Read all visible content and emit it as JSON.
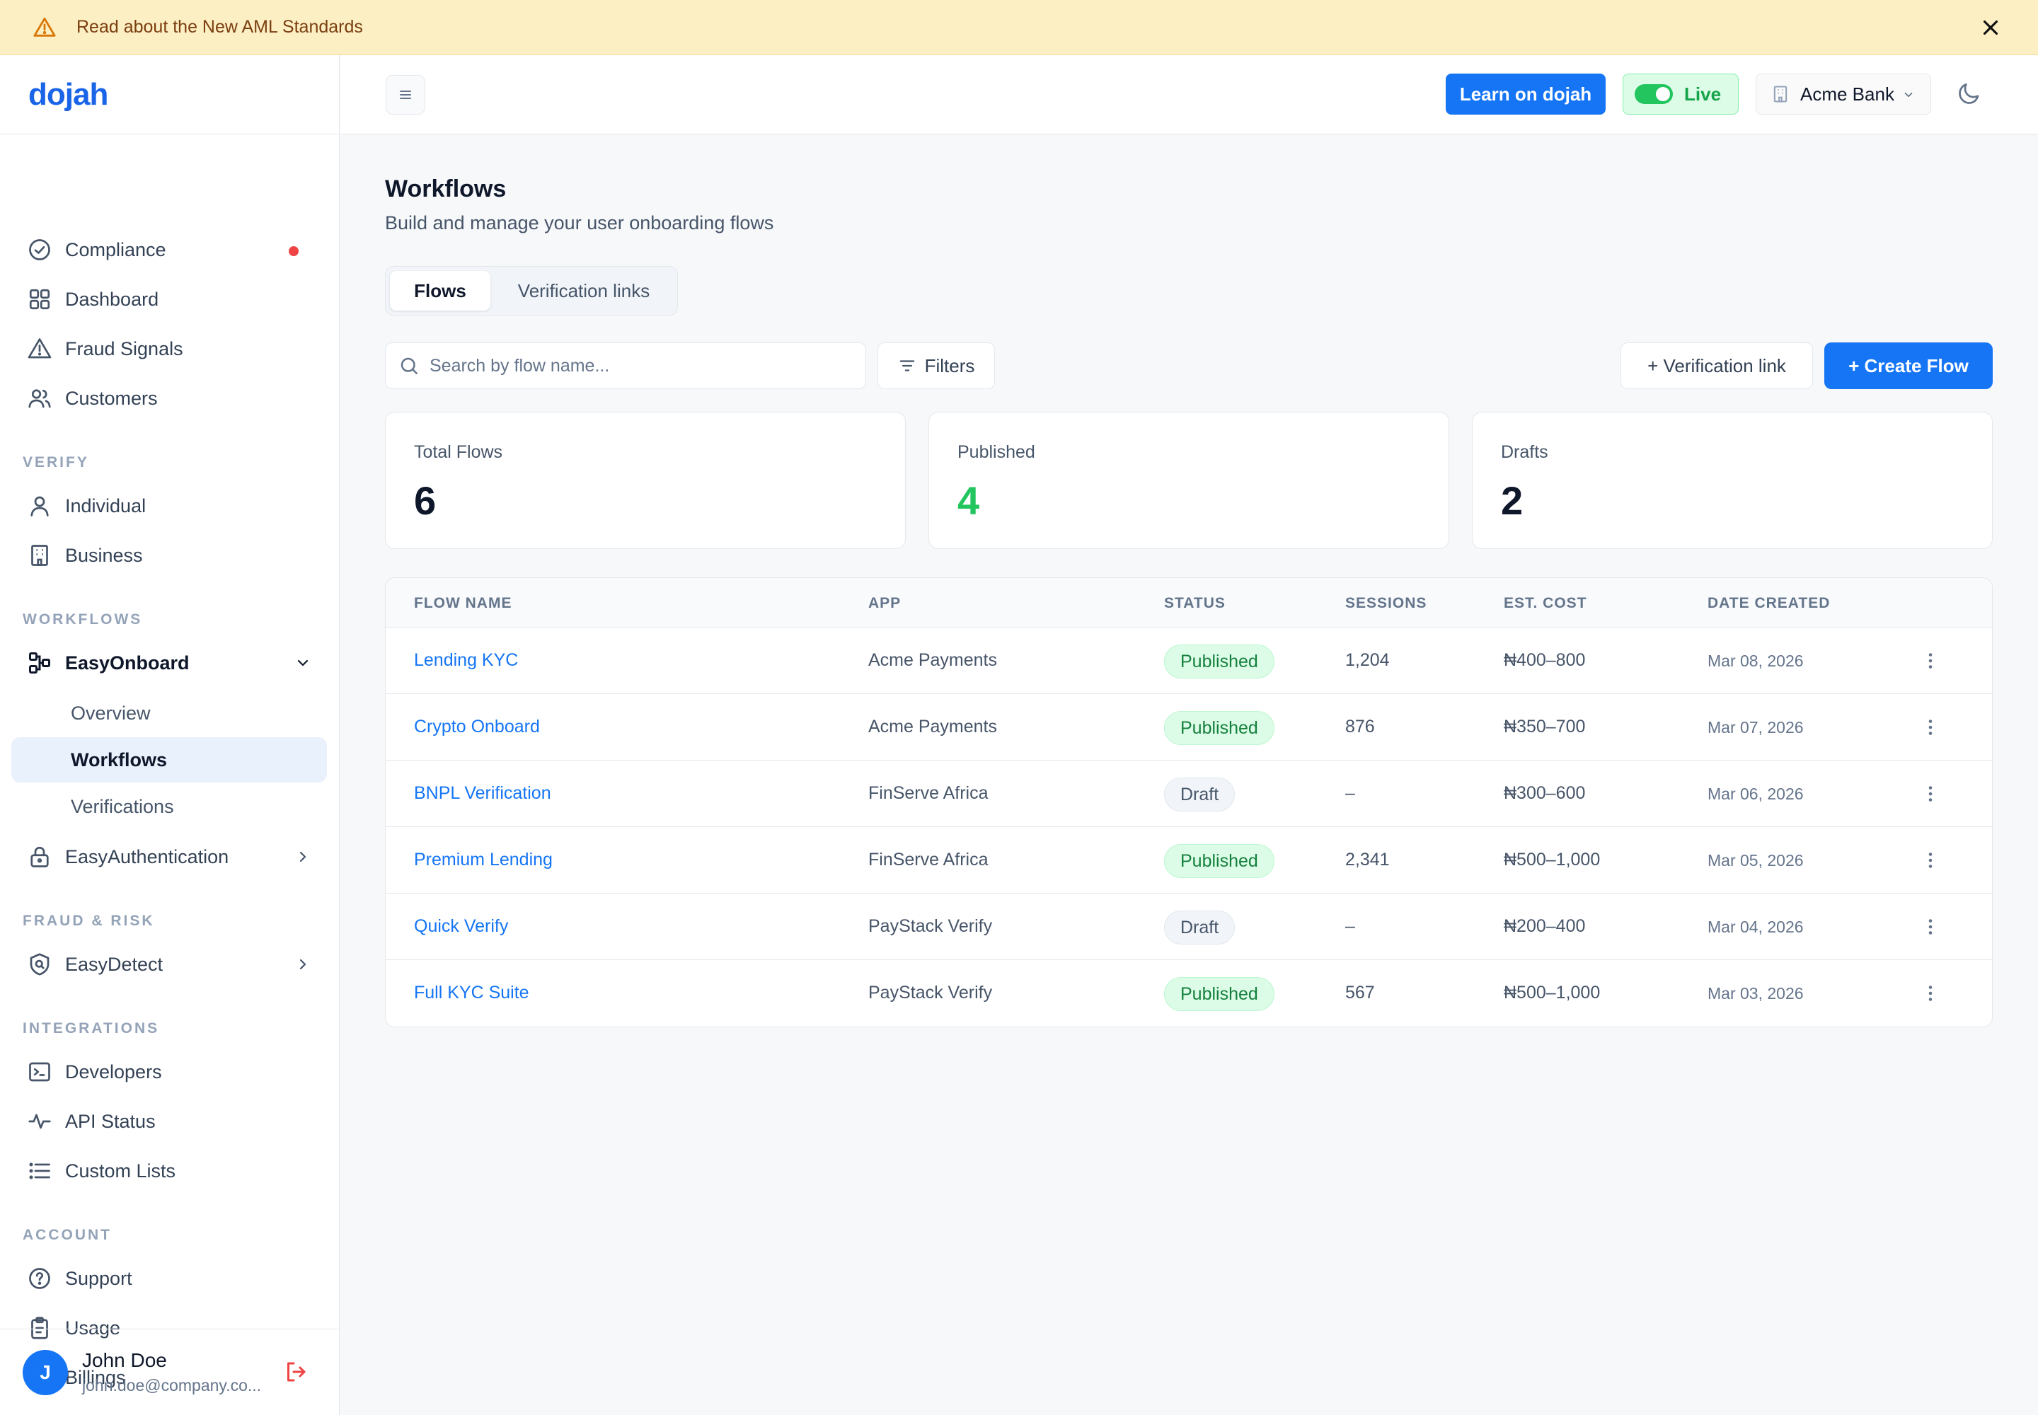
{
  "banner": {
    "text": "Read about the New AML Standards",
    "icon": "warning-icon"
  },
  "logo": "dojah",
  "sidebar": {
    "top_items": [
      {
        "label": "Compliance",
        "icon": "check-circle-icon",
        "alert_dot": true
      },
      {
        "label": "Dashboard",
        "icon": "grid-icon"
      },
      {
        "label": "Fraud Signals",
        "icon": "alert-triangle-icon"
      },
      {
        "label": "Customers",
        "icon": "users-icon"
      }
    ],
    "sections": {
      "verify": "VERIFY",
      "workflows": "WORKFLOWS",
      "fraud": "FRAUD & RISK",
      "integrations": "INTEGRATIONS",
      "account": "ACCOUNT"
    },
    "verify_items": [
      {
        "label": "Individual",
        "icon": "user-icon"
      },
      {
        "label": "Business",
        "icon": "building-icon"
      }
    ],
    "easyonboard": {
      "label": "EasyOnboard",
      "subitems": [
        "Overview",
        "Workflows",
        "Verifications"
      ],
      "active": "Workflows"
    },
    "easyauth": "EasyAuthentication",
    "easydetect": "EasyDetect",
    "integration_items": [
      {
        "label": "Developers",
        "icon": "terminal-icon"
      },
      {
        "label": "API Status",
        "icon": "activity-icon"
      },
      {
        "label": "Custom Lists",
        "icon": "list-icon"
      }
    ],
    "account_items": [
      {
        "label": "Support",
        "icon": "help-circle-icon"
      },
      {
        "label": "Usage",
        "icon": "clipboard-icon"
      },
      {
        "label": "Billings",
        "icon": "credit-card-icon"
      }
    ],
    "user": {
      "initial": "J",
      "name": "John Doe",
      "email": "john.doe@company.co..."
    }
  },
  "topbar": {
    "learn_label": "Learn on dojah",
    "live_label": "Live",
    "live_on": true,
    "org_label": "Acme Bank"
  },
  "page": {
    "title": "Workflows",
    "subtitle": "Build and manage your user onboarding flows",
    "tabs": [
      "Flows",
      "Verification links"
    ],
    "active_tab": "Flows",
    "search_placeholder": "Search by flow name...",
    "filters_label": "Filters",
    "vlink_label": "+ Verification link",
    "create_label": "+ Create Flow"
  },
  "stats": [
    {
      "label": "Total Flows",
      "value": "6"
    },
    {
      "label": "Published",
      "value": "4"
    },
    {
      "label": "Drafts",
      "value": "2"
    }
  ],
  "table": {
    "headers": [
      "FLOW NAME",
      "APP",
      "STATUS",
      "SESSIONS",
      "EST. COST",
      "DATE CREATED"
    ],
    "rows": [
      {
        "name": "Lending KYC",
        "app": "Acme Payments",
        "status": "Published",
        "sessions": "1,204",
        "cost": "₦400–800",
        "date": "Mar 08, 2026"
      },
      {
        "name": "Crypto Onboard",
        "app": "Acme Payments",
        "status": "Published",
        "sessions": "876",
        "cost": "₦350–700",
        "date": "Mar 07, 2026"
      },
      {
        "name": "BNPL Verification",
        "app": "FinServe Africa",
        "status": "Draft",
        "sessions": "–",
        "cost": "₦300–600",
        "date": "Mar 06, 2026"
      },
      {
        "name": "Premium Lending",
        "app": "FinServe Africa",
        "status": "Published",
        "sessions": "2,341",
        "cost": "₦500–1,000",
        "date": "Mar 05, 2026"
      },
      {
        "name": "Quick Verify",
        "app": "PayStack Verify",
        "status": "Draft",
        "sessions": "–",
        "cost": "₦200–400",
        "date": "Mar 04, 2026"
      },
      {
        "name": "Full KYC Suite",
        "app": "PayStack Verify",
        "status": "Published",
        "sessions": "567",
        "cost": "₦500–1,000",
        "date": "Mar 03, 2026"
      }
    ]
  },
  "colors": {
    "accent": "#1575f5",
    "live": "#22c55e",
    "banner_bg": "#fcefc4"
  }
}
